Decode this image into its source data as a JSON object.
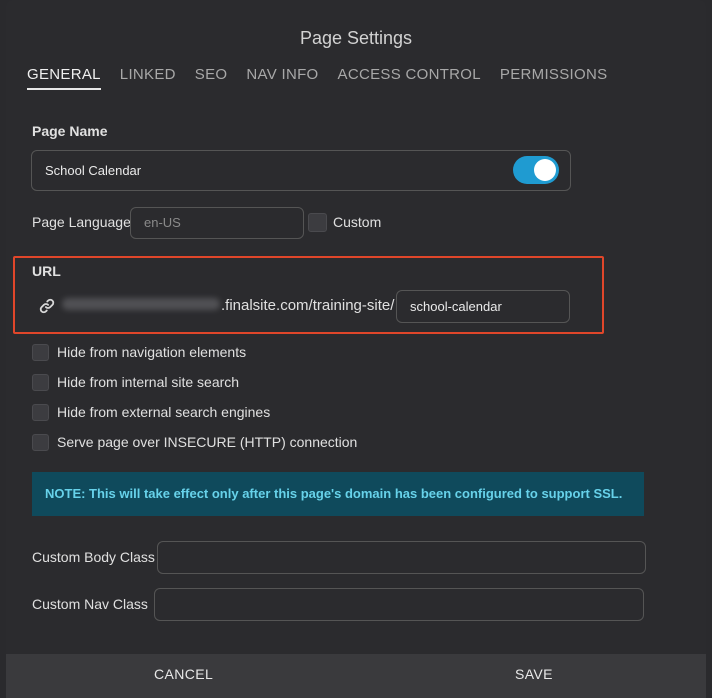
{
  "dialog": {
    "title": "Page Settings"
  },
  "tabs": [
    {
      "label": "GENERAL",
      "active": true
    },
    {
      "label": "LINKED"
    },
    {
      "label": "SEO"
    },
    {
      "label": "NAV INFO"
    },
    {
      "label": "ACCESS CONTROL"
    },
    {
      "label": "PERMISSIONS"
    }
  ],
  "page_name": {
    "label": "Page Name",
    "value": "School Calendar",
    "toggle_on": true
  },
  "page_language": {
    "label": "Page Language",
    "placeholder": "en-US",
    "custom_label": "Custom"
  },
  "url": {
    "label": "URL",
    "domain_suffix": ".finalsite.com/training-site/",
    "slug": "school-calendar"
  },
  "checkboxes": [
    {
      "label": "Hide from navigation elements"
    },
    {
      "label": "Hide from internal site search"
    },
    {
      "label": "Hide from external search engines"
    },
    {
      "label": "Serve page over INSECURE (HTTP) connection"
    }
  ],
  "note": {
    "text": "NOTE: This will take effect only after this page's domain has been configured to support SSL."
  },
  "custom_body_class": {
    "label": "Custom Body Class",
    "value": ""
  },
  "custom_nav_class": {
    "label": "Custom Nav Class",
    "value": ""
  },
  "footer": {
    "cancel_label": "CANCEL",
    "save_label": "SAVE"
  },
  "colors": {
    "accent": "#1f9bd1",
    "highlight_border": "#e0462a",
    "note_bg": "#0f4a5c",
    "note_text": "#67d2ea"
  },
  "icons": {
    "url": "link-icon"
  }
}
